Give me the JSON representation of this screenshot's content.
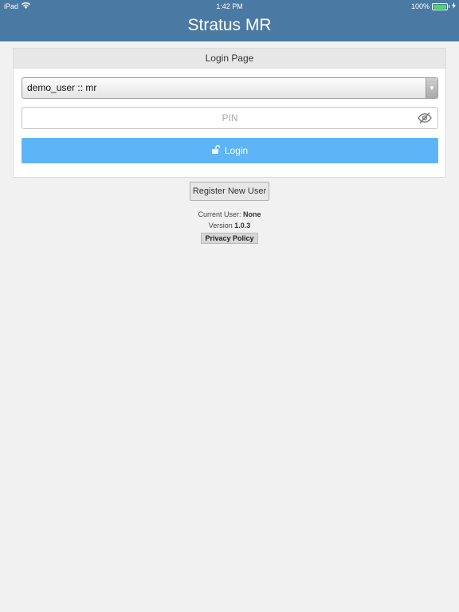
{
  "status_bar": {
    "device": "iPad",
    "time": "1:42 PM",
    "battery": "100%"
  },
  "header": {
    "title": "Stratus MR"
  },
  "login_panel": {
    "heading": "Login Page",
    "user_select": {
      "selected": "demo_user :: mr"
    },
    "pin": {
      "placeholder": "PIN",
      "value": ""
    },
    "login_label": "Login"
  },
  "register_label": "Register New User",
  "footer": {
    "current_user_label": "Current User:",
    "current_user_value": "None",
    "version_label": "Version",
    "version_value": "1.0.3",
    "privacy_label": "Privacy Policy"
  },
  "icons": [
    "wifi-icon",
    "battery-icon",
    "charging-icon",
    "dropdown-arrow-icon",
    "eye-slash-icon",
    "unlock-icon"
  ],
  "colors": {
    "header": "#4a7aa3",
    "login_button": "#5db5f7",
    "battery": "#4cd964",
    "background": "#f1f1f1"
  }
}
